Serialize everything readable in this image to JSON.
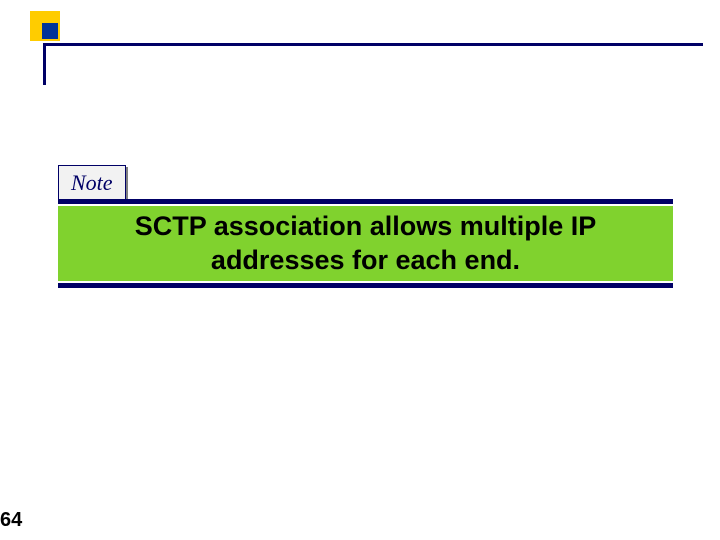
{
  "header": {
    "logo_outer_color": "#ffcc00",
    "logo_inner_color": "#003399"
  },
  "note": {
    "label": "Note"
  },
  "main": {
    "statement": "SCTP association allows multiple IP addresses for each end."
  },
  "footer": {
    "page_number": "64"
  }
}
